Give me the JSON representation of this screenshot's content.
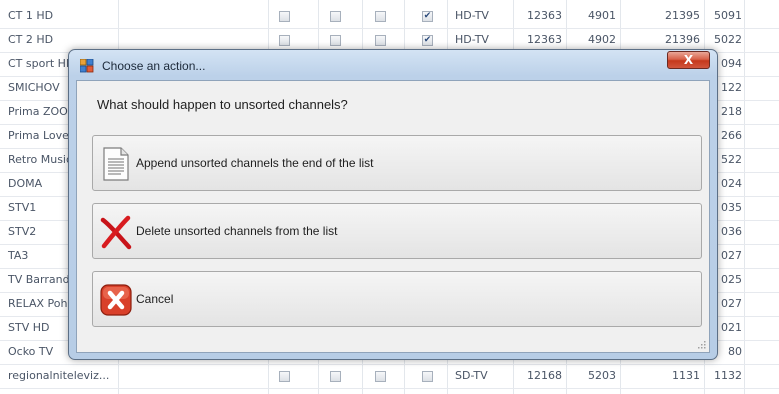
{
  "channels": [
    {
      "name": "CT 1 HD",
      "c1": false,
      "c2": false,
      "c3": false,
      "c4": true,
      "type": "HD-TV",
      "a": "12363",
      "b": "4901",
      "c": "21395",
      "d": "5091"
    },
    {
      "name": "CT 2 HD",
      "c1": false,
      "c2": false,
      "c3": false,
      "c4": true,
      "type": "HD-TV",
      "a": "12363",
      "b": "4902",
      "c": "21396",
      "d": "5022"
    },
    {
      "name": "CT sport HD",
      "c1": false,
      "c2": false,
      "c3": false,
      "c4": true,
      "type": "",
      "a": "",
      "b": "",
      "c": "",
      "d": "094"
    },
    {
      "name": "SMICHOV",
      "d": "122"
    },
    {
      "name": "Prima ZOOM",
      "d": "218"
    },
    {
      "name": "Prima Love",
      "d": "266"
    },
    {
      "name": "Retro Music",
      "d": "522"
    },
    {
      "name": "DOMA",
      "d": "024"
    },
    {
      "name": "STV1",
      "d": "035"
    },
    {
      "name": "STV2",
      "d": "036"
    },
    {
      "name": "TA3",
      "d": "027"
    },
    {
      "name": "TV Barrandov",
      "d": "025"
    },
    {
      "name": "RELAX Pohoda",
      "d": "027"
    },
    {
      "name": "STV HD",
      "d": "021"
    },
    {
      "name": "Ocko TV",
      "d": "80"
    },
    {
      "name": "regionalniteleviz...",
      "c1": false,
      "c2": false,
      "c3": false,
      "c4": false,
      "type": "SD-TV",
      "a": "12168",
      "b": "5203",
      "c": "1131",
      "d": "1132"
    }
  ],
  "dialog": {
    "title": "Choose an action...",
    "close_label": "X",
    "question": "What should happen to unsorted channels?",
    "actions": [
      {
        "label": "Append unsorted channels the end of the list",
        "icon": "document-icon"
      },
      {
        "label": "Delete unsorted channels from the list",
        "icon": "red-x-icon"
      },
      {
        "label": "Cancel",
        "icon": "cancel-icon"
      }
    ]
  }
}
